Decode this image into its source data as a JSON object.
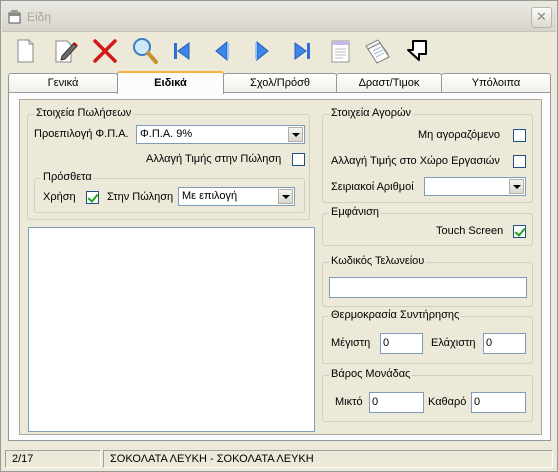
{
  "window": {
    "title": "Είδη",
    "close_glyph": "✕"
  },
  "toolbar": {
    "buttons": [
      {
        "icon": "new-document-icon"
      },
      {
        "icon": "edit-pen-icon"
      },
      {
        "icon": "delete-x-icon"
      },
      {
        "icon": "search-magnifier-icon"
      },
      {
        "icon": "first-record-icon"
      },
      {
        "icon": "previous-record-icon"
      },
      {
        "icon": "next-record-icon"
      },
      {
        "icon": "last-record-icon"
      },
      {
        "icon": "notepad-icon"
      },
      {
        "icon": "documents-icon"
      },
      {
        "icon": "return-arrow-icon"
      }
    ]
  },
  "tabs": [
    {
      "label": "Γενικά",
      "active": false
    },
    {
      "label": "Ειδικά",
      "active": true
    },
    {
      "label": "Σχολ/Πρόσθ",
      "active": false
    },
    {
      "label": "Δραστ/Τιμοκ",
      "active": false
    },
    {
      "label": "Υπόλοιπα",
      "active": false
    }
  ],
  "sales": {
    "legend": "Στοιχεία Πωλήσεων",
    "vat_label": "Προεπιλογή Φ.Π.Α.",
    "vat_value": "Φ.Π.Α. 9%",
    "price_change_label": "Αλλαγή Τιμής στην Πώληση",
    "price_change_checked": false,
    "extras": {
      "legend": "Πρόσθετα",
      "use_label": "Χρήση",
      "use_checked": true,
      "at_sale_label": "Στην Πώληση",
      "at_sale_value": "Με επιλογή"
    }
  },
  "purchases": {
    "legend": "Στοιχεία Αγορών",
    "not_purchased_label": "Μη αγοραζόμενο",
    "not_purchased_checked": false,
    "workspace_price_label": "Αλλαγή Τιμής στο Χώρο Εργασιών",
    "workspace_price_checked": false,
    "serials_label": "Σειριακοί Αριθμοί",
    "serials_value": ""
  },
  "display": {
    "legend": "Εμφάνιση",
    "touch_label": "Touch Screen",
    "touch_checked": true
  },
  "customs": {
    "legend": "Κωδικός Τελωνείου",
    "value": ""
  },
  "temperature": {
    "legend": "Θερμοκρασία Συντήρησης",
    "max_label": "Μέγιστη",
    "max_value": "0",
    "min_label": "Ελάχιστη",
    "min_value": "0"
  },
  "weight": {
    "legend": "Βάρος Μονάδας",
    "gross_label": "Μικτό",
    "gross_value": "0",
    "net_label": "Καθαρό",
    "net_value": "0"
  },
  "status": {
    "record": "2/17",
    "item": "ΣΟΚΟΛΑΤΑ ΛΕΥΚΗ - ΣΟΚΟΛΑΤΑ ΛΕΥΚΗ"
  }
}
